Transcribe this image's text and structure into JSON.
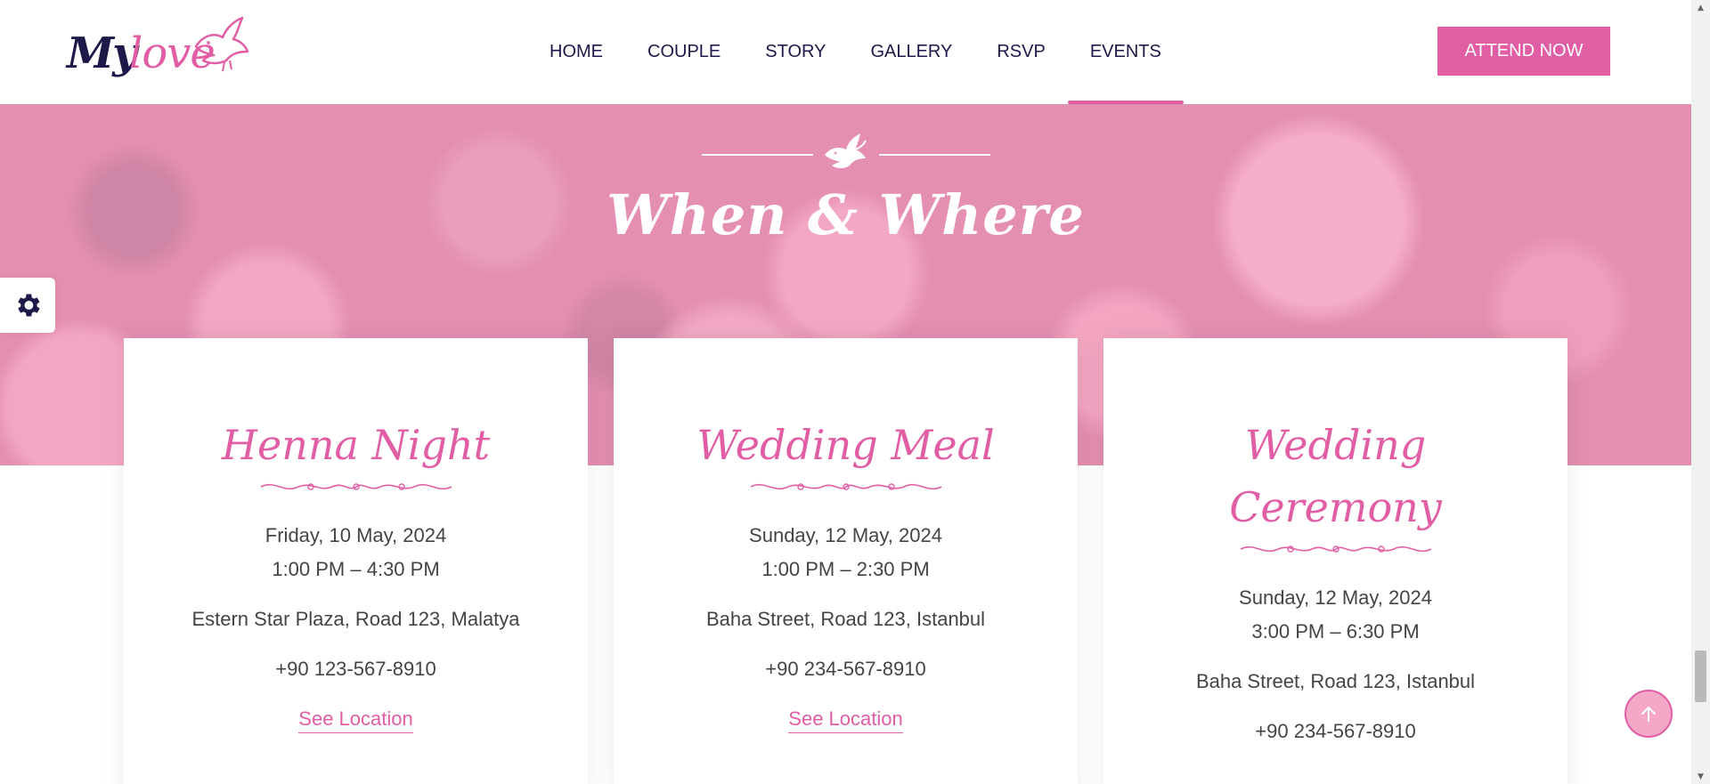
{
  "logo": {
    "part1": "My",
    "part2": "love"
  },
  "nav": {
    "items": [
      "HOME",
      "COUPLE",
      "STORY",
      "GALLERY",
      "RSVP",
      "EVENTS"
    ],
    "active": "EVENTS",
    "cta_label": "ATTEND NOW"
  },
  "hero": {
    "title": "When & Where"
  },
  "events": [
    {
      "title": "Henna Night",
      "date": "Friday, 10 May, 2024",
      "time": "1:00 PM – 4:30 PM",
      "address": "Estern Star Plaza, Road 123, Malatya",
      "phone": "+90 123-567-8910",
      "link": "See Location"
    },
    {
      "title": "Wedding Meal",
      "date": "Sunday, 12 May, 2024",
      "time": "1:00 PM – 2:30 PM",
      "address": "Baha Street, Road 123, Istanbul",
      "phone": "+90 234-567-8910",
      "link": "See Location"
    },
    {
      "title_line1": "Wedding",
      "title_line2": "Ceremony",
      "date": "Sunday, 12 May, 2024",
      "time": "3:00 PM – 6:30 PM",
      "address": "Baha Street, Road 123, Istanbul",
      "phone": "+90 234-567-8910"
    }
  ],
  "icons": {
    "logo": "dove-icon",
    "hero": "dove-icon",
    "settings": "gear-icon",
    "back_to_top": "arrow-up-icon",
    "divider": "swirl-divider-icon"
  },
  "colors": {
    "accent": "#e15ea5",
    "navy": "#1d1a4a",
    "hero_overlay": "#e49ab7"
  }
}
